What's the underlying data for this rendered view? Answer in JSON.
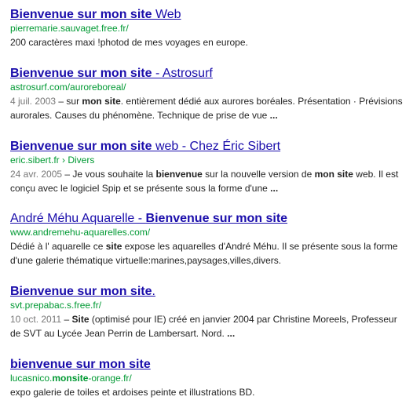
{
  "results": [
    {
      "title_bold": "Bienvenue sur mon site",
      "title_rest": " Web",
      "url": "pierremarie.sauvaget.free.fr/",
      "snippet": "200 caractères maxi !photod de mes voyages en europe."
    },
    {
      "title_bold": "Bienvenue sur mon site",
      "title_rest": " - Astrosurf",
      "url": "astrosurf.com/auroreboreal/",
      "date": "4 juil. 2003",
      "snippet_parts": [
        " – sur ",
        "mon site",
        ". entièrement dédié aux aurores boréales. Présentation · Prévisions aurorales. Causes du phénomène. Technique de prise de vue ",
        "..."
      ]
    },
    {
      "title_bold": "Bienvenue sur mon site",
      "title_rest": " web - Chez Éric Sibert",
      "url": "eric.sibert.fr › Divers",
      "date": "24 avr. 2005",
      "snippet_parts": [
        " – Je vous souhaite la ",
        "bienvenue",
        " sur la nouvelle version de ",
        "mon site",
        " web. Il est conçu avec le logiciel Spip et se présente sous la forme d'une ",
        "..."
      ]
    },
    {
      "title_plain": "André Méhu Aquarelle - ",
      "title_bold": "Bienvenue sur mon site",
      "url": "www.andremehu-aquarelles.com/",
      "snippet_parts": [
        "Dédié à l' aquarelle ce ",
        "site",
        " expose les aquarelles d'André Méhu. Il se présente sous la forme d'une galerie thématique virtuelle:marines,paysages,villes,divers."
      ]
    },
    {
      "title_bold": "Bienvenue sur mon site",
      "title_rest": ".",
      "url": "svt.prepabac.s.free.fr/",
      "date": "10 oct. 2011",
      "snippet_parts": [
        " – ",
        "Site",
        " (optimisé pour IE) créé en janvier 2004 par Christine Moreels, Professeur de SVT au Lycée Jean Perrin de Lambersart. Nord. ",
        "..."
      ]
    },
    {
      "title_bold": "bienvenue sur mon site",
      "url_parts": [
        "lucasnico.",
        "monsite",
        "-orange.fr/"
      ],
      "snippet": "expo galerie de toiles et ardoises peinte et illustrations BD."
    }
  ]
}
